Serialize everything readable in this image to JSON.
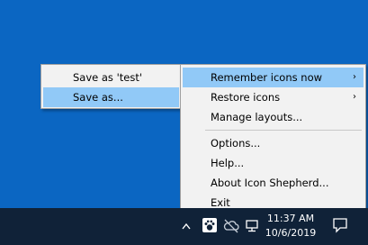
{
  "submenu": {
    "items": [
      {
        "label": "Save as 'test'"
      },
      {
        "label": "Save as..."
      }
    ]
  },
  "menu": {
    "items": [
      {
        "label": "Remember icons now",
        "submenu_arrow": "›"
      },
      {
        "label": "Restore icons",
        "submenu_arrow": "›"
      },
      {
        "label": "Manage layouts..."
      },
      {
        "label": "Options..."
      },
      {
        "label": "Help..."
      },
      {
        "label": "About Icon Shepherd..."
      },
      {
        "label": "Exit"
      }
    ]
  },
  "taskbar": {
    "clock": {
      "time": "11:37 AM",
      "date": "10/6/2019"
    },
    "tray_icons": [
      "chevron-up-icon",
      "paw-icon",
      "cloud-offline-icon",
      "network-icon",
      "notification-icon"
    ]
  },
  "colors": {
    "desktop": "#0b66c2",
    "taskbar": "#102238",
    "menu_bg": "#f2f2f2",
    "highlight": "#91c9f7"
  }
}
